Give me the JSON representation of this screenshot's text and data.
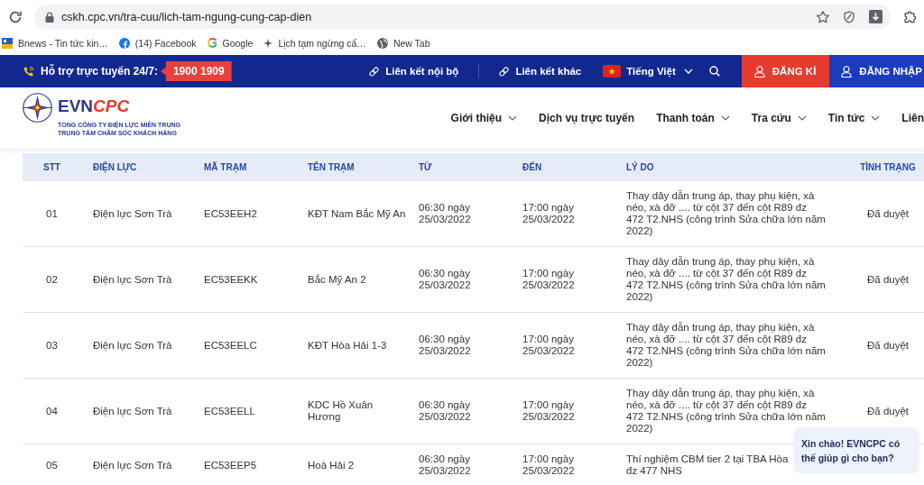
{
  "browser": {
    "url": "cskh.cpc.vn/tra-cuu/lich-tam-ngung-cung-cap-dien",
    "bookmarks": [
      {
        "kind": "bnews",
        "label": "Bnews - Tin tức kin…"
      },
      {
        "kind": "facebook",
        "label": "(14) Facebook"
      },
      {
        "kind": "google",
        "label": "Google"
      },
      {
        "kind": "evn",
        "label": "Lịch tạm ngừng cấ…"
      },
      {
        "kind": "globe",
        "label": "New Tab"
      }
    ]
  },
  "topbar": {
    "support_label": "Hỗ trợ trực tuyến 24/7:",
    "hotline": "1900 1909",
    "links": [
      "Liên kết nội bộ",
      "Liên kết khác"
    ],
    "language": "Tiếng Việt",
    "register": "ĐĂNG KÍ",
    "login": "ĐĂNG NHẬP"
  },
  "header": {
    "brand_main": "EVN",
    "brand_accent": "CPC",
    "tagline_1": "TỔNG CÔNG TY ĐIỆN LỰC MIỀN TRUNG",
    "tagline_2": "TRUNG TÂM CHĂM SÓC KHÁCH HÀNG",
    "nav": [
      {
        "label": "Giới thiệu",
        "dropdown": true
      },
      {
        "label": "Dịch vụ trực tuyến",
        "dropdown": false
      },
      {
        "label": "Thanh toán",
        "dropdown": true
      },
      {
        "label": "Tra cứu",
        "dropdown": true
      },
      {
        "label": "Tin tức",
        "dropdown": true
      },
      {
        "label": "Liên",
        "dropdown": false
      }
    ]
  },
  "table": {
    "columns": [
      "STT",
      "ĐIỆN LỰC",
      "MÃ TRẠM",
      "TÊN TRẠM",
      "TỪ",
      "ĐẾN",
      "LÝ DO",
      "TÌNH TRẠNG"
    ],
    "rows": [
      {
        "stt": "01",
        "dien_luc": "Điện lực Sơn Trà",
        "ma_tram": "EC53EEH2",
        "ten_tram": "KĐT Nam Bắc Mỹ An",
        "tu": "06:30 ngày 25/03/2022",
        "den": "17:00 ngày 25/03/2022",
        "ly_do": "Thay dây dẫn trung áp, thay phụ kiện, xà\nnéo, xà đỡ .... từ cột 37 đến cột R89 đz\n472 T2.NHS (công trình Sửa chữa lớn năm\n2022)",
        "tinh_trang": "Đã duyệt"
      },
      {
        "stt": "02",
        "dien_luc": "Điện lực Sơn Trà",
        "ma_tram": "EC53EEKK",
        "ten_tram": "Bắc Mỹ An 2",
        "tu": "06:30 ngày 25/03/2022",
        "den": "17:00 ngày 25/03/2022",
        "ly_do": "Thay dây dẫn trung áp, thay phụ kiện, xà\nnéo, xà đỡ .... từ cột 37 đến cột R89 đz\n472 T2.NHS (công trình Sửa chữa lớn năm\n2022)",
        "tinh_trang": "Đã duyệt"
      },
      {
        "stt": "03",
        "dien_luc": "Điện lực Sơn Trà",
        "ma_tram": "EC53EELC",
        "ten_tram": "KĐT Hòa Hải 1-3",
        "tu": "06:30 ngày 25/03/2022",
        "den": "17:00 ngày 25/03/2022",
        "ly_do": "Thay dây dẫn trung áp, thay phụ kiện, xà\nnéo, xà đỡ .... từ cột 37 đến cột R89 đz\n472 T2.NHS (công trình Sửa chữa lớn năm\n2022)",
        "tinh_trang": "Đã duyệt"
      },
      {
        "stt": "04",
        "dien_luc": "Điện lực Sơn Trà",
        "ma_tram": "EC53EELL",
        "ten_tram": "KDC Hồ Xuân Hương",
        "tu": "06:30 ngày 25/03/2022",
        "den": "17:00 ngày 25/03/2022",
        "ly_do": "Thay dây dẫn trung áp, thay phụ kiện, xà\nnéo, xà đỡ .... từ cột 37 đến cột R89 đz\n472 T2.NHS (công trình Sửa chữa lớn năm\n2022)",
        "tinh_trang": "Đã duyệt"
      },
      {
        "stt": "05",
        "dien_luc": "Điện lực Sơn Trà",
        "ma_tram": "EC53EEP5",
        "ten_tram": "Hoà Hải 2",
        "tu": "06:30 ngày 25/03/2022",
        "den": "17:00 ngày 25/03/2022",
        "ly_do": "Thí nghiệm CBM tier 2 tại TBA Hòa\nđz 477 NHS"
      }
    ]
  },
  "chat": {
    "message": "Xin chào! EVNCPC có thế giúp gì cho bạn?"
  }
}
